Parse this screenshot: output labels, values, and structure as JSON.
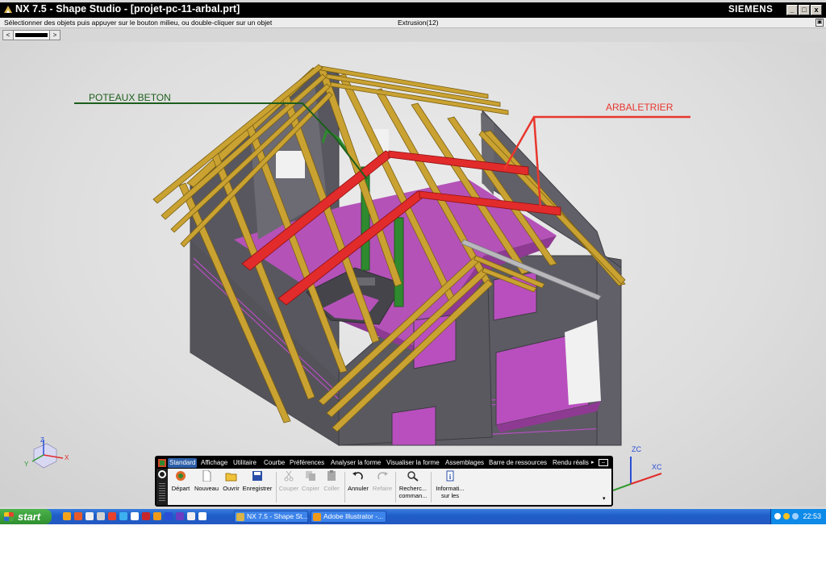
{
  "window": {
    "title": "NX 7.5 - Shape Studio - [projet-pc-11-arbal.prt]",
    "brand": "SIEMENS",
    "controls": [
      "_",
      "□",
      "x"
    ]
  },
  "statusbar": {
    "prompt": "Sélectionner des objets puis appuyer sur le bouton milieu, ou double-cliquer sur un objet",
    "status": "Extrusion(12)"
  },
  "slider": {
    "left_arrow": "<",
    "right_arrow": ">"
  },
  "annotations": {
    "green_label": "POTEAUX BETON",
    "red_label": "ARBALETRIER"
  },
  "triad": {
    "x": "X",
    "y": "Y",
    "z": "Z"
  },
  "wcs": {
    "zc": "ZC",
    "xc": "XC"
  },
  "ribbon": {
    "tabs": [
      "Standard",
      "Affichage",
      "Utilitaire",
      "Courbe",
      "Préférences",
      "Analyser la forme",
      "Visualiser la forme",
      "Assemblages",
      "Barre de ressources",
      "Rendu réalis"
    ],
    "tools": [
      {
        "label": "Départ",
        "icon": "start-icon"
      },
      {
        "label": "Nouveau",
        "icon": "new-file-icon"
      },
      {
        "label": "Ouvrir",
        "icon": "open-folder-icon"
      },
      {
        "label": "Enregistrer",
        "icon": "save-icon"
      },
      {
        "label": "Couper",
        "icon": "cut-icon"
      },
      {
        "label": "Copier",
        "icon": "copy-icon"
      },
      {
        "label": "Coller",
        "icon": "paste-icon"
      },
      {
        "label": "Annuler",
        "icon": "undo-icon"
      },
      {
        "label": "Refaire",
        "icon": "redo-icon"
      },
      {
        "label": "Recherc... comman...",
        "icon": "command-finder-icon"
      },
      {
        "label": "Informati... sur les",
        "icon": "information-icon"
      }
    ]
  },
  "taskbar": {
    "start": "start",
    "tasks": [
      "NX 7.5 - Shape St...",
      "Adobe Illustrator -..."
    ],
    "clock": "22:53"
  },
  "colors": {
    "wall": "#5a5961",
    "floor": "#b452b8",
    "beam_wood": "#c9a232",
    "arbaletrier": "#e22b2b",
    "poteau": "#2f8a2f",
    "window_pink": "#b94fbe"
  }
}
